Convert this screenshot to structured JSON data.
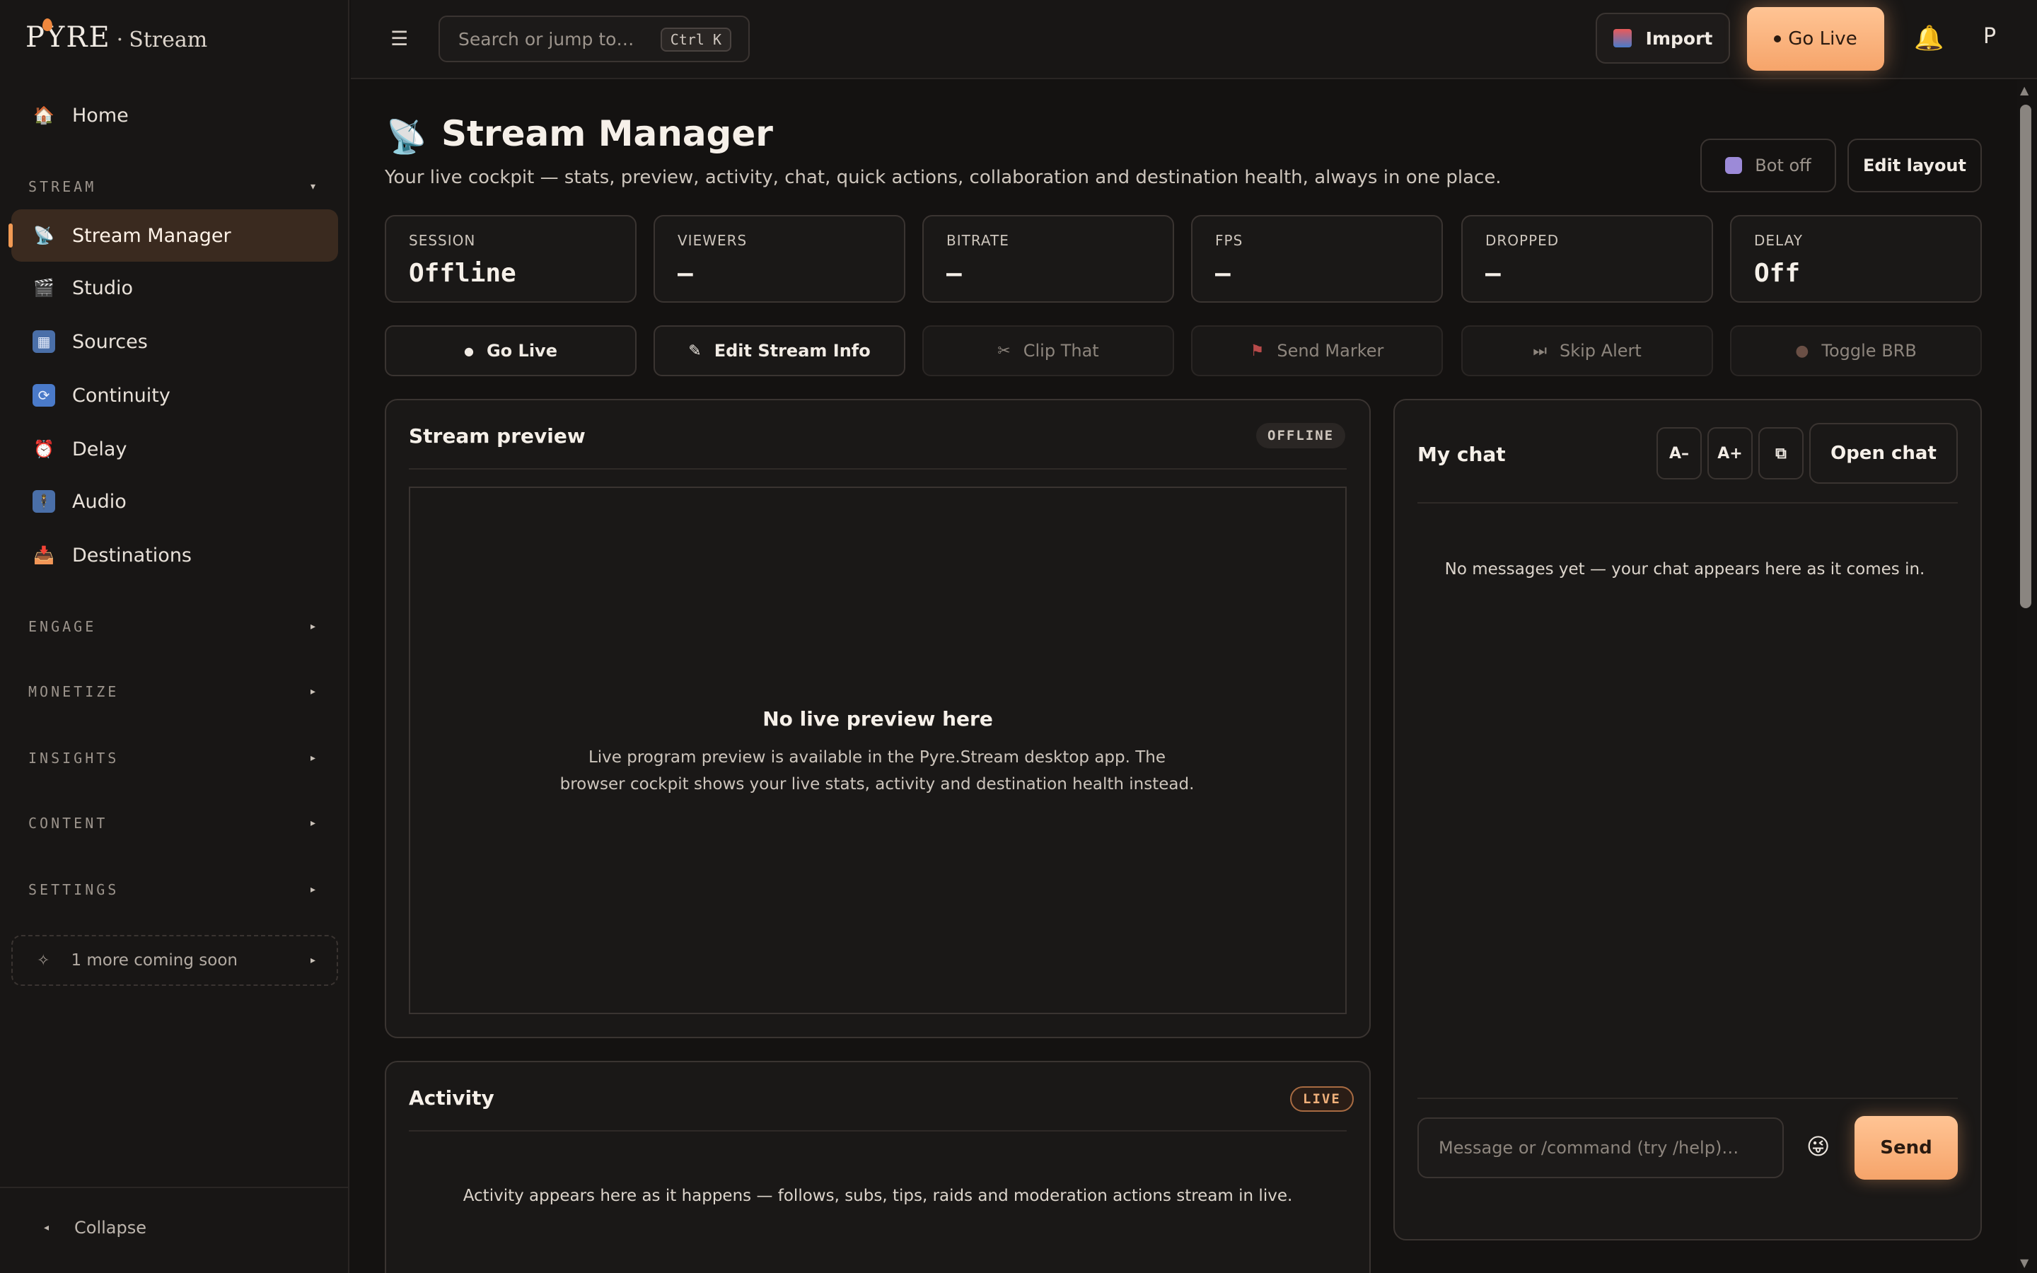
{
  "sidebar": {
    "logo": {
      "brand": "PYRE",
      "separator": "·",
      "sub": "Stream"
    },
    "home": {
      "label": "Home",
      "icon": "house-icon"
    },
    "stream_group": {
      "label": "STREAM",
      "caret": "▾"
    },
    "items": [
      {
        "label": "Stream Manager",
        "icon": "satellite-dish-icon",
        "active": true
      },
      {
        "label": "Studio",
        "icon": "clapperboard-icon"
      },
      {
        "label": "Sources",
        "icon": "grid-icon"
      },
      {
        "label": "Continuity",
        "icon": "repeat-icon"
      },
      {
        "label": "Delay",
        "icon": "alarm-clock-icon"
      },
      {
        "label": "Audio",
        "icon": "person-standing-icon"
      },
      {
        "label": "Destinations",
        "icon": "inbox-tray-icon"
      }
    ],
    "groups": [
      {
        "label": "ENGAGE",
        "caret": "▸"
      },
      {
        "label": "MONETIZE",
        "caret": "▸"
      },
      {
        "label": "INSIGHTS",
        "caret": "▸"
      },
      {
        "label": "CONTENT",
        "caret": "▸"
      },
      {
        "label": "SETTINGS",
        "caret": "▸"
      }
    ],
    "coming_soon": {
      "label": "1 more coming soon",
      "icon": "sparkle-icon",
      "caret": "▸"
    },
    "collapse": {
      "label": "Collapse",
      "caret": "◂"
    }
  },
  "topbar": {
    "menu_icon": "☰",
    "search": {
      "placeholder": "Search or jump to…",
      "shortcut": "Ctrl K"
    },
    "import_label": "Import",
    "go_live_label": "Go Live",
    "profile_initial": "P"
  },
  "header": {
    "title": "Stream Manager",
    "subtitle": "Your live cockpit — stats, preview, activity, chat, quick actions, collaboration and destination health, always in one place.",
    "bot_label": "Bot off",
    "edit_layout_label": "Edit layout"
  },
  "stats": [
    {
      "label": "SESSION",
      "value": "Offline"
    },
    {
      "label": "VIEWERS",
      "value": "—"
    },
    {
      "label": "BITRATE",
      "value": "—"
    },
    {
      "label": "FPS",
      "value": "—"
    },
    {
      "label": "DROPPED",
      "value": "—"
    },
    {
      "label": "DELAY",
      "value": "Off"
    }
  ],
  "quick_actions": [
    {
      "label": "Go Live",
      "icon": "dot-icon",
      "glyph": "●",
      "enabled": true
    },
    {
      "label": "Edit Stream Info",
      "icon": "pencil-icon",
      "glyph": "✎",
      "enabled": true
    },
    {
      "label": "Clip That",
      "icon": "scissors-icon",
      "glyph": "✂",
      "enabled": false
    },
    {
      "label": "Send Marker",
      "icon": "flag-icon",
      "glyph": "⚑",
      "enabled": false
    },
    {
      "label": "Skip Alert",
      "icon": "skip-forward-icon",
      "glyph": "⏭",
      "enabled": false
    },
    {
      "label": "Toggle BRB",
      "icon": "coffee-icon",
      "glyph": "●",
      "enabled": false
    }
  ],
  "preview": {
    "title": "Stream preview",
    "badge": "OFFLINE",
    "empty_title": "No live preview here",
    "empty_text": "Live program preview is available in the Pyre.Stream desktop app. The browser cockpit shows your live stats, activity and destination health instead."
  },
  "activity": {
    "title": "Activity",
    "badge": "LIVE",
    "empty_text": "Activity appears here as it happens — follows, subs, tips, raids and moderation actions stream in live."
  },
  "chat": {
    "title": "My chat",
    "font_down_label": "A–",
    "font_up_label": "A+",
    "popout_icon": "popout-window-icon",
    "open_label": "Open chat",
    "empty_text": "No messages yet — your chat appears here as it comes in.",
    "input_placeholder": "Message or /command (try /help)…",
    "emoji_icon": "emoji-icon",
    "send_label": "Send"
  },
  "colors": {
    "accent": "#f6a46a",
    "background": "#141211",
    "panel": "#1a1817",
    "border": "#3a3431"
  }
}
